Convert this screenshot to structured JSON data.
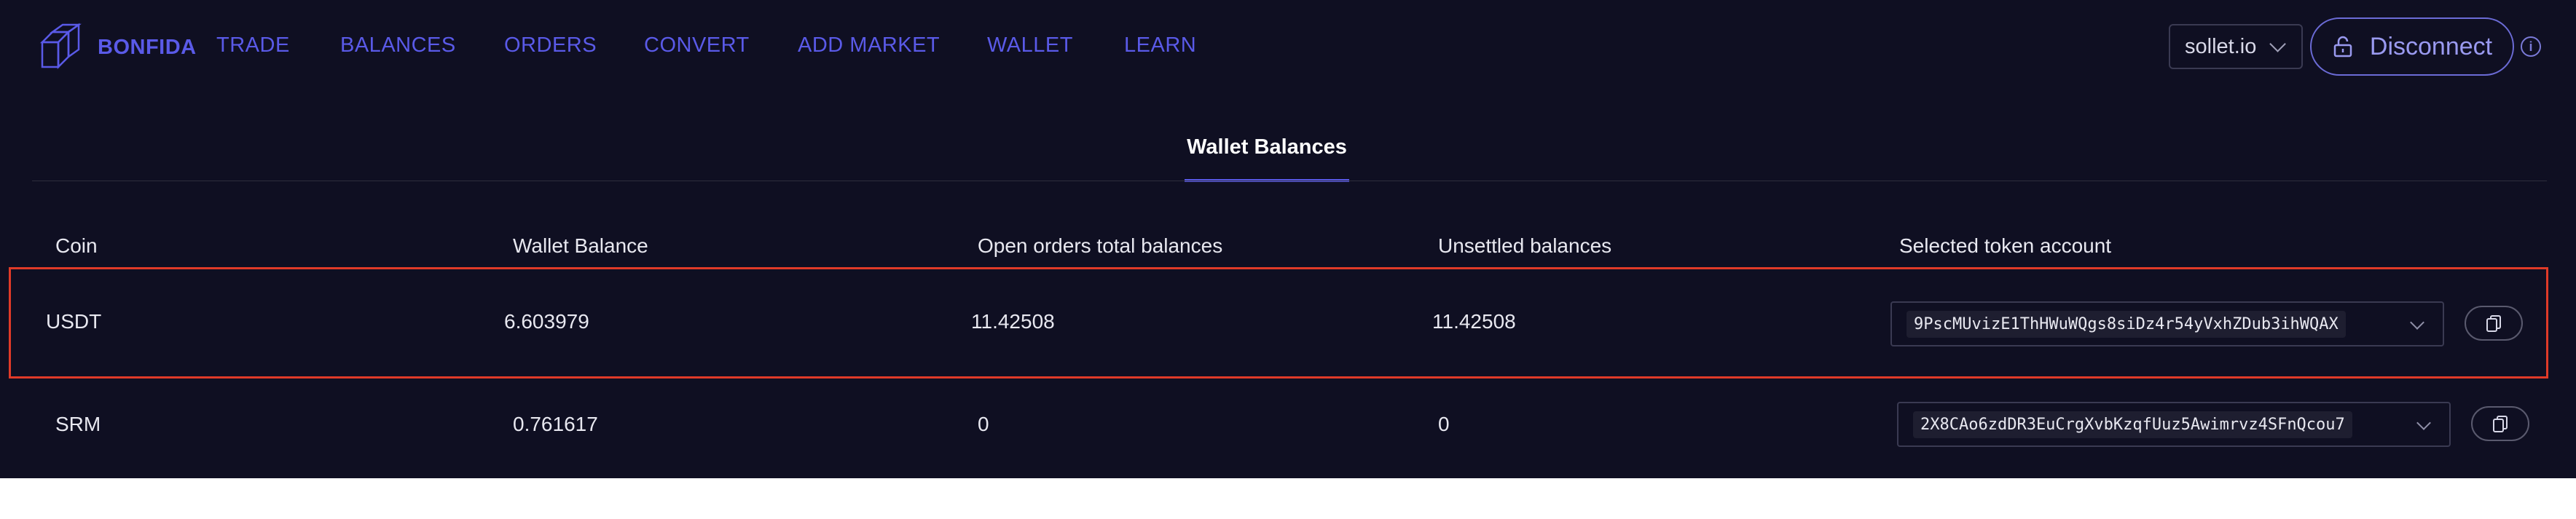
{
  "brand": {
    "name": "BONFIDA"
  },
  "nav": {
    "items": [
      {
        "label": "TRADE"
      },
      {
        "label": "BALANCES"
      },
      {
        "label": "ORDERS"
      },
      {
        "label": "CONVERT"
      },
      {
        "label": "ADD MARKET"
      },
      {
        "label": "WALLET"
      },
      {
        "label": "LEARN"
      }
    ],
    "wallet_provider": "sollet.io",
    "disconnect_label": "Disconnect",
    "info_glyph": "i"
  },
  "tabs": [
    {
      "label": "Wallet Balances",
      "active": true
    }
  ],
  "table": {
    "headers": {
      "coin": "Coin",
      "wallet_balance": "Wallet Balance",
      "open_orders": "Open orders total balances",
      "unsettled": "Unsettled balances",
      "token_account": "Selected token account"
    },
    "rows": [
      {
        "coin": "USDT",
        "wallet_balance": "6.603979",
        "open_orders": "11.42508",
        "unsettled": "11.42508",
        "token_account": "9PscMUvizE1ThHWuWQgs8siDz4r54yVxhZDub3ihWQAX",
        "highlighted": true
      },
      {
        "coin": "SRM",
        "wallet_balance": "0.761617",
        "open_orders": "0",
        "unsettled": "0",
        "token_account": "2X8CAo6zdDR3EuCrgXvbKzqfUuz5Awimrvz4SFnQcou7",
        "highlighted": false
      }
    ]
  },
  "colors": {
    "background": "#0f0f22",
    "accent": "#5a5ae8",
    "highlight_border": "#e03a28"
  }
}
